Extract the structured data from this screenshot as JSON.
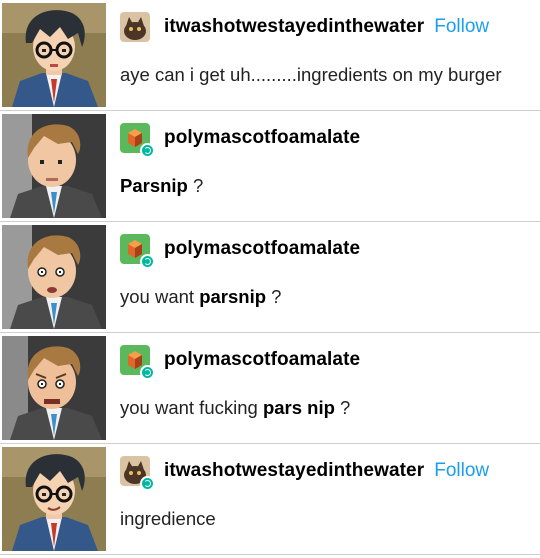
{
  "posts": [
    {
      "username": "itwashotwestayedinthewater",
      "follow_label": "Follow",
      "avatar_icon": "cat-avatar-icon",
      "text": "aye can i get uh.........ingredients on my burger"
    },
    {
      "username": "polymascotfoamalate",
      "avatar_icon": "cube-avatar-icon",
      "bold": "Parsnip",
      "after": " ?"
    },
    {
      "username": "polymascotfoamalate",
      "avatar_icon": "cube-avatar-icon",
      "before": "you want ",
      "bold": "parsnip",
      "after": " ?"
    },
    {
      "username": "polymascotfoamalate",
      "avatar_icon": "cube-avatar-icon",
      "before": "you want fucking ",
      "bold": "pars nip",
      "after": " ?"
    },
    {
      "username": "itwashotwestayedinthewater",
      "follow_label": "Follow",
      "avatar_icon": "cat-avatar-icon",
      "text": "ingredience"
    }
  ],
  "colors": {
    "follow": "#1a9eef",
    "reblog": "#00b8a0",
    "divider": "#cfcfcf"
  }
}
